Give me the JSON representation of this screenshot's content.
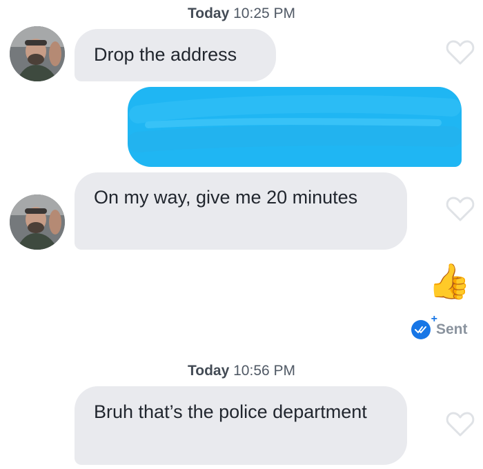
{
  "timestamps": [
    {
      "day": "Today",
      "time": "10:25 PM"
    },
    {
      "day": "Today",
      "time": "10:56 PM"
    }
  ],
  "messages": [
    {
      "text": "Drop the address"
    },
    {
      "text": "On my way, give me 20 minutes"
    },
    {
      "text": "Bruh that’s the police department"
    }
  ],
  "reaction_emoji": "👍",
  "status": {
    "label": "Sent"
  },
  "colors": {
    "incoming_bubble": "#e9eaee",
    "outgoing_bubble": "#1fb6f3",
    "timestamp": "#505965",
    "sent_check": "#1776e6"
  },
  "icons": [
    "heart-outline-icon",
    "double-check-icon",
    "thumbs-up-emoji"
  ]
}
